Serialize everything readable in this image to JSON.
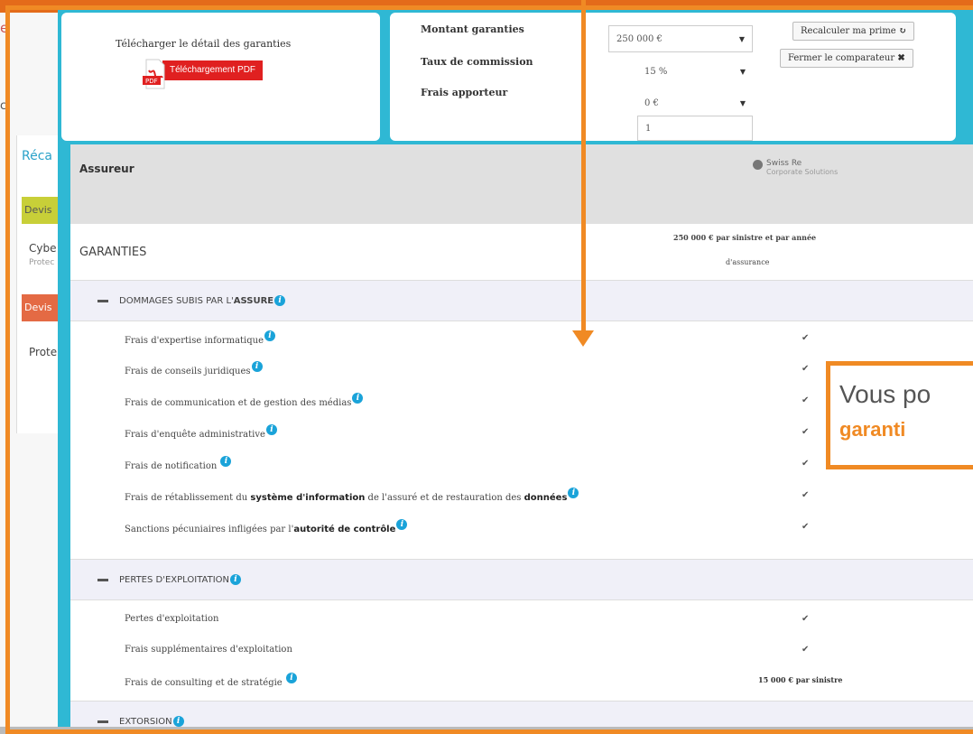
{
  "background": {
    "e_fragment": "e",
    "c_fragment": "c",
    "reca": "Réca",
    "devis1": "Devis",
    "cybe": "Cybe",
    "protec_small": "Protec",
    "devis2": "Devis",
    "prote": "Prote"
  },
  "download": {
    "title": "Télécharger le détail des garanties",
    "pdf_label": "Téléchargement PDF",
    "pdf_icon_text": "PDF"
  },
  "controls": {
    "montant_label": "Montant garanties",
    "montant_value": "250 000 €",
    "taux_label": "Taux de commission",
    "taux_value": "15 %",
    "frais_label": "Frais apporteur",
    "frais_value": "0 €",
    "frais_input_value": "1",
    "recalc_label": "Recalculer ma prime",
    "close_label": "Fermer le comparateur"
  },
  "table": {
    "assureur_label": "Assureur",
    "insurer_name": "Swiss Re",
    "insurer_sub": "Corporate Solutions",
    "garanties_label": "GARANTIES",
    "garanties_value_line1": "250 000 € par sinistre et par année",
    "garanties_value_line2": "d'assurance",
    "sections": {
      "s1_prefix": "DOMMAGES SUBIS PAR L'",
      "s1_bold": "ASSURE",
      "s2": "PERTES D'EXPLOITATION",
      "s3": "EXTORSION"
    },
    "items": {
      "i1": "Frais d'expertise informatique",
      "i2": "Frais de conseils juridiques",
      "i3": "Frais de communication et de gestion des médias",
      "i4": "Frais d'enquête administrative",
      "i5": "Frais de notification",
      "i6_a": "Frais de rétablissement du ",
      "i6_b": "système d'information",
      "i6_c": " de l'assuré et de restauration des ",
      "i6_d": "données",
      "i7_a": "Sanctions pécuniaires infligées par l'",
      "i7_b": "autorité de contrôle",
      "i8": "Pertes d'exploitation",
      "i9": "Frais supplémentaires d'exploitation",
      "i10": "Frais de consulting et de stratégie",
      "i10_value": "15 000 € par sinistre"
    },
    "check": "✔",
    "info": "i"
  },
  "callout": {
    "line1": "Vous po",
    "line2": "garanti"
  },
  "colors": {
    "accent_orange": "#f08a24",
    "modal_teal": "#2fb8d4",
    "info_blue": "#1aa3d9",
    "pdf_red": "#e02020"
  }
}
